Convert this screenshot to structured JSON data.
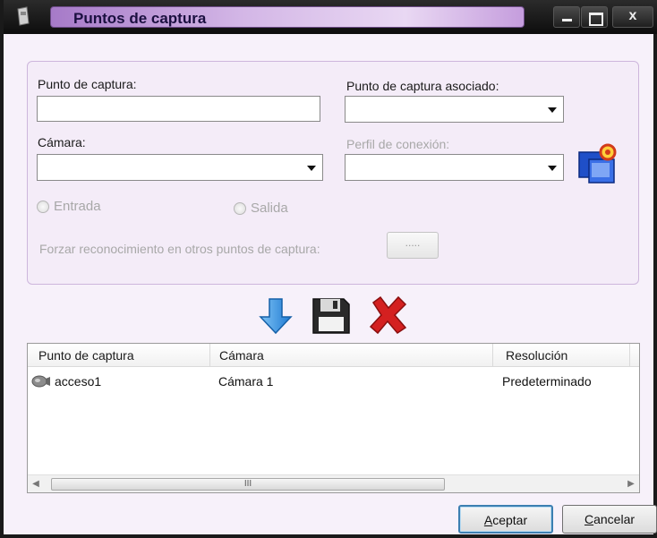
{
  "window": {
    "title": "Puntos de captura",
    "close_label": "x"
  },
  "form": {
    "capture_point_label": "Punto de captura:",
    "capture_point_value": "",
    "associated_point_label": "Punto de captura asociado:",
    "associated_point_value": "",
    "camera_label": "Cámara:",
    "camera_value": "",
    "connection_profile_label": "Perfil de conexión:",
    "connection_profile_value": "",
    "entrada_label": "Entrada",
    "salida_label": "Salida",
    "force_recognition_label": "Forzar reconocimiento en otros puntos de captura:",
    "dots_button_label": "....."
  },
  "actions": {
    "icons": [
      "down-arrow-icon",
      "save-disk-icon",
      "delete-x-icon"
    ]
  },
  "list": {
    "columns": [
      "Punto de captura",
      "Cámara",
      "Resolución"
    ],
    "rows": [
      {
        "point": "acceso1",
        "camera": "Cámara 1",
        "resolution": "Predeterminado"
      }
    ],
    "scroll_thumb_label": "III"
  },
  "buttons": {
    "accept_first": "A",
    "accept_rest": "ceptar",
    "cancel_first": "C",
    "cancel_rest": "ancelar"
  },
  "colors": {
    "title_gradient": "#a67ac8",
    "window_bg": "#f7f1fa",
    "accent_blue": "#3c7fb1",
    "delete_red": "#d42020"
  }
}
